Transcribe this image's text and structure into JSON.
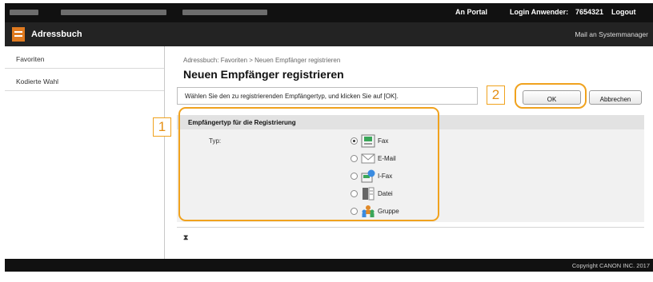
{
  "topbar": {
    "portal_link": "An Portal",
    "login_label": "Login Anwender:",
    "login_user": "7654321",
    "logout_link": "Logout"
  },
  "appbar": {
    "title": "Adressbuch",
    "mail_link": "Mail an Systemmanager",
    "logo_icon": "addressbook-icon"
  },
  "sidebar": {
    "items": [
      {
        "label": "Favoriten"
      },
      {
        "label": "Kodierte Wahl"
      }
    ]
  },
  "main": {
    "breadcrumb": "Adressbuch: Favoriten > Neuen Empfänger registrieren",
    "title": "Neuen Empfänger registrieren",
    "instruction": "Wählen Sie den zu registrierenden Empfängertyp, und klicken Sie auf [OK].",
    "ok_label": "OK",
    "cancel_label": "Abbrechen",
    "section_title": "Empfängertyp für die Registrierung",
    "type_label": "Typ:",
    "options": [
      {
        "label": "Fax",
        "icon": "fax-icon",
        "selected": true
      },
      {
        "label": "E-Mail",
        "icon": "email-icon",
        "selected": false
      },
      {
        "label": "I-Fax",
        "icon": "ifax-icon",
        "selected": false
      },
      {
        "label": "Datei",
        "icon": "file-icon",
        "selected": false
      },
      {
        "label": "Gruppe",
        "icon": "group-icon",
        "selected": false
      }
    ],
    "to_top_symbol": "⧗"
  },
  "footer": {
    "copyright": "Copyright CANON INC. 2017"
  },
  "callouts": {
    "one": "1",
    "two": "2"
  },
  "colors": {
    "highlight": "#f0a21e",
    "logo": "#e07a1f",
    "topbar": "#111111",
    "appbar": "#232323"
  }
}
